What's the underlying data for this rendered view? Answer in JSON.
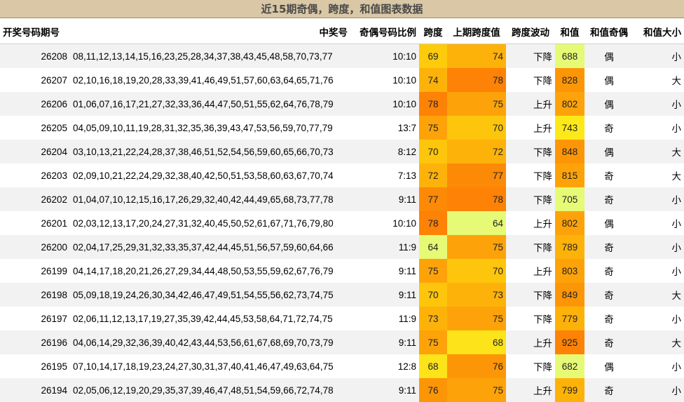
{
  "title": "近15期奇偶，跨度，和值图表数据",
  "headers": [
    "开奖号码期号",
    "中奖号",
    "奇偶号码比例",
    "跨度",
    "上期跨度值",
    "跨度波动",
    "和值",
    "和值奇偶",
    "和值大小"
  ],
  "heat_colors": {
    "64": "#e6fa76",
    "68": "#fce31a",
    "69": "#fdcb0c",
    "70": "#fdc50c",
    "72": "#fdb20a",
    "73": "#fdb20a",
    "74": "#fdb20a",
    "75": "#fda309",
    "76": "#fd9607",
    "77": "#fd8a06",
    "78": "#fd8205",
    "682": "#e6fa76",
    "688": "#e6fa76",
    "705": "#e6fa76",
    "743": "#fde91a",
    "779": "#fdb20a",
    "789": "#fdb20a",
    "799": "#fdb20a",
    "802": "#fda309",
    "803": "#fda309",
    "815": "#fda309",
    "828": "#fd9607",
    "848": "#fd9607",
    "849": "#fd9607",
    "925": "#fd8205"
  },
  "rows": [
    {
      "period": "26208",
      "numbers": "08,11,12,13,14,15,16,23,25,28,34,37,38,43,45,48,58,70,73,77",
      "ratio": "10:10",
      "span": "69",
      "prev_span": "74",
      "trend": "下降",
      "sum": "688",
      "sum_parity": "偶",
      "sum_size": "小"
    },
    {
      "period": "26207",
      "numbers": "02,10,16,18,19,20,28,33,39,41,46,49,51,57,60,63,64,65,71,76",
      "ratio": "10:10",
      "span": "74",
      "prev_span": "78",
      "trend": "下降",
      "sum": "828",
      "sum_parity": "偶",
      "sum_size": "大"
    },
    {
      "period": "26206",
      "numbers": "01,06,07,16,17,21,27,32,33,36,44,47,50,51,55,62,64,76,78,79",
      "ratio": "10:10",
      "span": "78",
      "prev_span": "75",
      "trend": "上升",
      "sum": "802",
      "sum_parity": "偶",
      "sum_size": "小"
    },
    {
      "period": "26205",
      "numbers": "04,05,09,10,11,19,28,31,32,35,36,39,43,47,53,56,59,70,77,79",
      "ratio": "13:7",
      "span": "75",
      "prev_span": "70",
      "trend": "上升",
      "sum": "743",
      "sum_parity": "奇",
      "sum_size": "小"
    },
    {
      "period": "26204",
      "numbers": "03,10,13,21,22,24,28,37,38,46,51,52,54,56,59,60,65,66,70,73",
      "ratio": "8:12",
      "span": "70",
      "prev_span": "72",
      "trend": "下降",
      "sum": "848",
      "sum_parity": "偶",
      "sum_size": "大"
    },
    {
      "period": "26203",
      "numbers": "02,09,10,21,22,24,29,32,38,40,42,50,51,53,58,60,63,67,70,74",
      "ratio": "7:13",
      "span": "72",
      "prev_span": "77",
      "trend": "下降",
      "sum": "815",
      "sum_parity": "奇",
      "sum_size": "大"
    },
    {
      "period": "26202",
      "numbers": "01,04,07,10,12,15,16,17,26,29,32,40,42,44,49,65,68,73,77,78",
      "ratio": "9:11",
      "span": "77",
      "prev_span": "78",
      "trend": "下降",
      "sum": "705",
      "sum_parity": "奇",
      "sum_size": "小"
    },
    {
      "period": "26201",
      "numbers": "02,03,12,13,17,20,24,27,31,32,40,45,50,52,61,67,71,76,79,80",
      "ratio": "10:10",
      "span": "78",
      "prev_span": "64",
      "trend": "上升",
      "sum": "802",
      "sum_parity": "偶",
      "sum_size": "小"
    },
    {
      "period": "26200",
      "numbers": "02,04,17,25,29,31,32,33,35,37,42,44,45,51,56,57,59,60,64,66",
      "ratio": "11:9",
      "span": "64",
      "prev_span": "75",
      "trend": "下降",
      "sum": "789",
      "sum_parity": "奇",
      "sum_size": "小"
    },
    {
      "period": "26199",
      "numbers": "04,14,17,18,20,21,26,27,29,34,44,48,50,53,55,59,62,67,76,79",
      "ratio": "9:11",
      "span": "75",
      "prev_span": "70",
      "trend": "上升",
      "sum": "803",
      "sum_parity": "奇",
      "sum_size": "小"
    },
    {
      "period": "26198",
      "numbers": "05,09,18,19,24,26,30,34,42,46,47,49,51,54,55,56,62,73,74,75",
      "ratio": "9:11",
      "span": "70",
      "prev_span": "73",
      "trend": "下降",
      "sum": "849",
      "sum_parity": "奇",
      "sum_size": "大"
    },
    {
      "period": "26197",
      "numbers": "02,06,11,12,13,17,19,27,35,39,42,44,45,53,58,64,71,72,74,75",
      "ratio": "11:9",
      "span": "73",
      "prev_span": "75",
      "trend": "下降",
      "sum": "779",
      "sum_parity": "奇",
      "sum_size": "小"
    },
    {
      "period": "26196",
      "numbers": "04,06,14,29,32,36,39,40,42,43,44,53,56,61,67,68,69,70,73,79",
      "ratio": "9:11",
      "span": "75",
      "prev_span": "68",
      "trend": "上升",
      "sum": "925",
      "sum_parity": "奇",
      "sum_size": "大"
    },
    {
      "period": "26195",
      "numbers": "07,10,14,17,18,19,23,24,27,30,31,37,40,41,46,47,49,63,64,75",
      "ratio": "12:8",
      "span": "68",
      "prev_span": "76",
      "trend": "下降",
      "sum": "682",
      "sum_parity": "偶",
      "sum_size": "小"
    },
    {
      "period": "26194",
      "numbers": "02,05,06,12,19,20,29,35,37,39,46,47,48,51,54,59,66,72,74,78",
      "ratio": "9:11",
      "span": "76",
      "prev_span": "75",
      "trend": "上升",
      "sum": "799",
      "sum_parity": "奇",
      "sum_size": "小"
    }
  ]
}
